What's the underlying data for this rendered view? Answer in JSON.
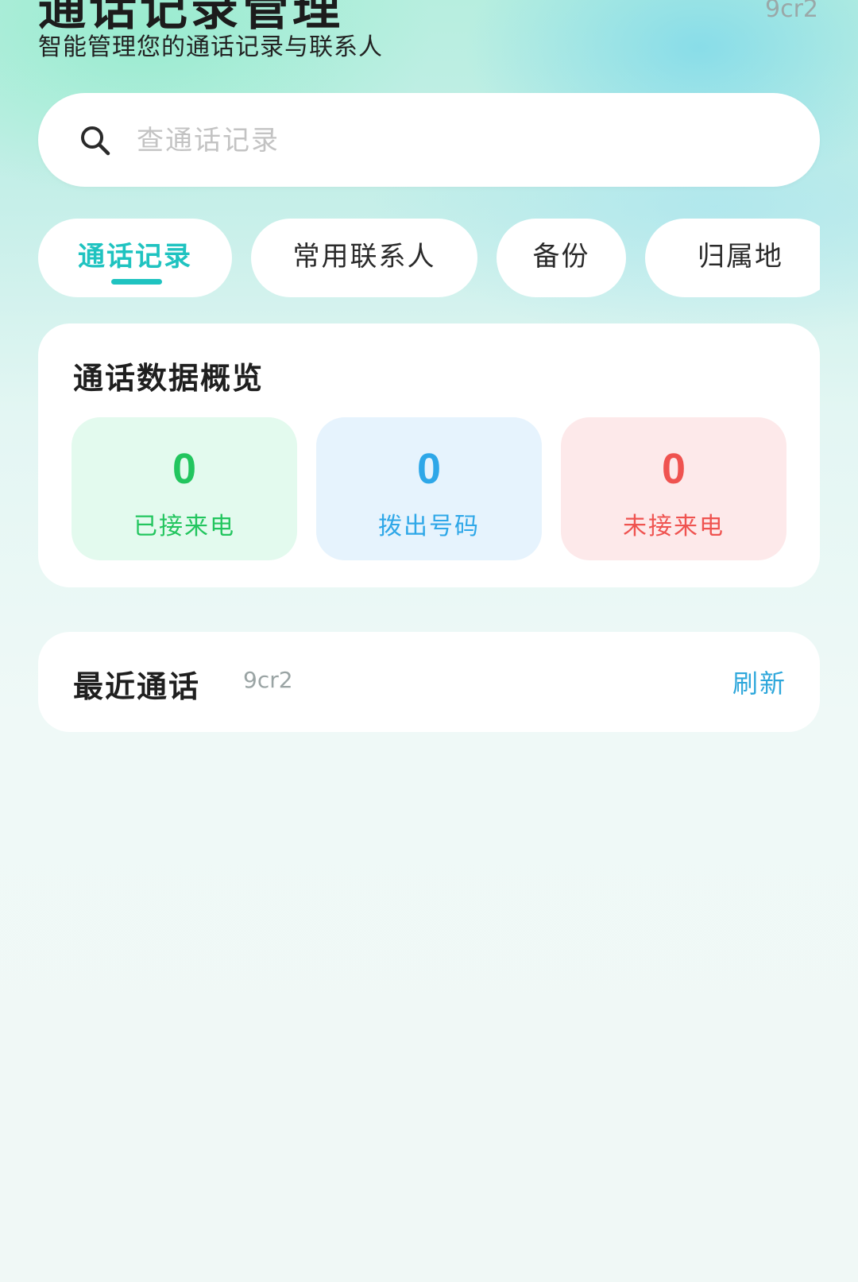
{
  "header": {
    "title": "通话记录管理",
    "subtitle": "智能管理您的通话记录与联系人",
    "tag": "9cr2"
  },
  "search": {
    "placeholder": "查通话记录",
    "value": ""
  },
  "tabs": [
    {
      "label": "通话记录",
      "active": true
    },
    {
      "label": "常用联系人",
      "active": false
    },
    {
      "label": "备份",
      "active": false
    },
    {
      "label": "归属地",
      "active": false
    }
  ],
  "overview": {
    "title": "通话数据概览",
    "stats": [
      {
        "value": "0",
        "label": "已接来电",
        "color": "#22c55e",
        "bg": "#e3faee"
      },
      {
        "value": "0",
        "label": "拨出号码",
        "color": "#2ea7e8",
        "bg": "#e6f3fd"
      },
      {
        "value": "0",
        "label": "未接来电",
        "color": "#ef5350",
        "bg": "#fde9ea"
      }
    ]
  },
  "recent": {
    "title": "最近通话",
    "tag": "9cr2",
    "refresh_label": "刷新"
  },
  "colors": {
    "accent": "#1fc3c0",
    "link": "#2ea7db"
  },
  "icons": {
    "search": "search-icon"
  }
}
